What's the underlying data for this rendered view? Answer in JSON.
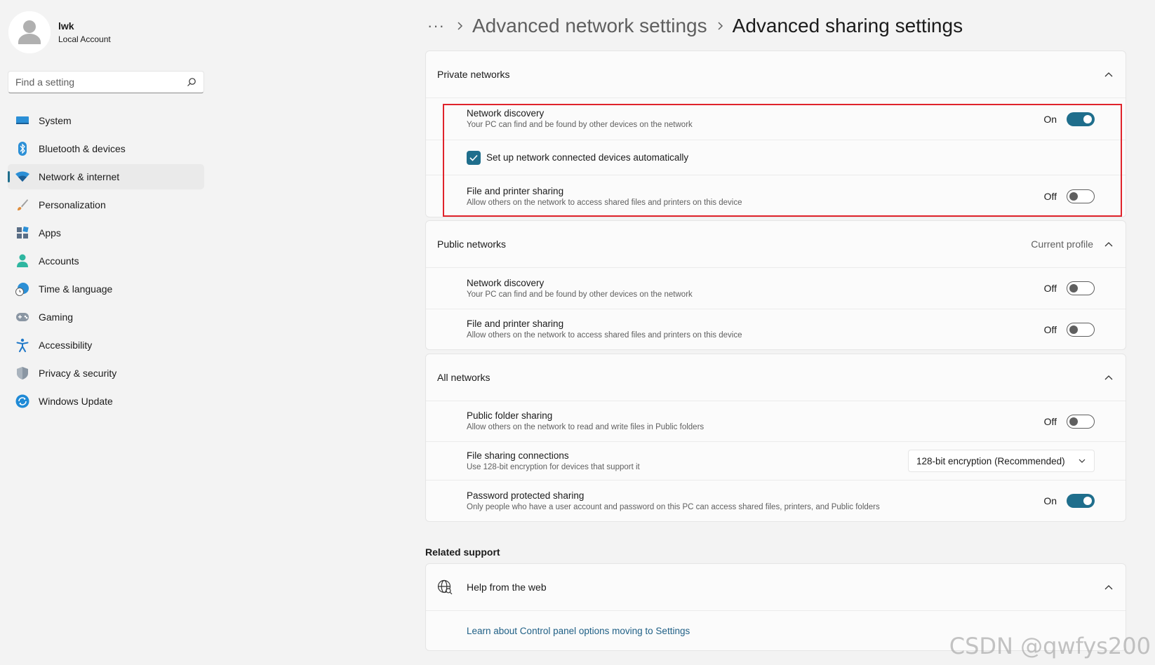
{
  "user": {
    "name": "lwk",
    "account_type": "Local Account"
  },
  "search": {
    "placeholder": "Find a setting"
  },
  "nav": [
    {
      "label": "System",
      "icon": "monitor-icon"
    },
    {
      "label": "Bluetooth & devices",
      "icon": "bluetooth-icon"
    },
    {
      "label": "Network & internet",
      "icon": "wifi-icon",
      "active": true
    },
    {
      "label": "Personalization",
      "icon": "brush-icon"
    },
    {
      "label": "Apps",
      "icon": "apps-icon"
    },
    {
      "label": "Accounts",
      "icon": "person-icon"
    },
    {
      "label": "Time & language",
      "icon": "clock-globe-icon"
    },
    {
      "label": "Gaming",
      "icon": "gamepad-icon"
    },
    {
      "label": "Accessibility",
      "icon": "accessibility-icon"
    },
    {
      "label": "Privacy & security",
      "icon": "shield-icon"
    },
    {
      "label": "Windows Update",
      "icon": "update-icon"
    }
  ],
  "breadcrumb": {
    "more": "···",
    "parent": "Advanced network settings",
    "current": "Advanced sharing settings"
  },
  "private_networks": {
    "title": "Private networks",
    "network_discovery": {
      "title": "Network discovery",
      "desc": "Your PC can find and be found by other devices on the network",
      "state": "On"
    },
    "auto_setup": {
      "label": "Set up network connected devices automatically",
      "checked": true
    },
    "file_printer": {
      "title": "File and printer sharing",
      "desc": "Allow others on the network to access shared files and printers on this device",
      "state": "Off"
    }
  },
  "public_networks": {
    "title": "Public networks",
    "badge": "Current profile",
    "network_discovery": {
      "title": "Network discovery",
      "desc": "Your PC can find and be found by other devices on the network",
      "state": "Off"
    },
    "file_printer": {
      "title": "File and printer sharing",
      "desc": "Allow others on the network to access shared files and printers on this device",
      "state": "Off"
    }
  },
  "all_networks": {
    "title": "All networks",
    "public_folder": {
      "title": "Public folder sharing",
      "desc": "Allow others on the network to read and write files in Public folders",
      "state": "Off"
    },
    "file_connections": {
      "title": "File sharing connections",
      "desc": "Use 128-bit encryption for devices that support it",
      "value": "128-bit encryption (Recommended)"
    },
    "password_sharing": {
      "title": "Password protected sharing",
      "desc": "Only people who have a user account and password on this PC can access shared files, printers, and Public folders",
      "state": "On"
    }
  },
  "related_support": {
    "label": "Related support",
    "help_title": "Help from the web",
    "link": "Learn about Control panel options moving to Settings"
  },
  "watermark": "CSDN @qwfys200",
  "colors": {
    "accent": "#1f6e8c",
    "highlight": "#e0232b"
  }
}
